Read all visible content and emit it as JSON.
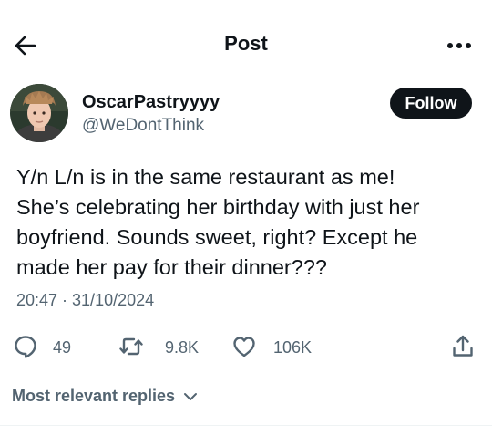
{
  "header": {
    "title": "Post",
    "back_icon": "arrow-left-icon",
    "more_icon": "more-horizontal-icon"
  },
  "author": {
    "display_name": "OscarPastryyyy",
    "handle": "@WeDontThink",
    "avatar_icon": "avatar-photo"
  },
  "follow_button": {
    "label": "Follow",
    "bg_color": "#0f1419",
    "text_color": "#ffffff"
  },
  "tweet": {
    "lines": [
      "Y/n L/n is in the same restaurant as me!",
      "She’s celebrating her birthday with just her",
      "boyfriend. Sounds sweet, right? Except he",
      "made her pay for their dinner???"
    ],
    "timestamp": "20:47 · 31/10/2024"
  },
  "actions": {
    "replies": {
      "icon": "reply-icon",
      "count": "49"
    },
    "reposts": {
      "icon": "repost-icon",
      "count": "9.8K"
    },
    "likes": {
      "icon": "heart-icon",
      "count": "106K"
    },
    "share": {
      "icon": "share-icon"
    }
  },
  "replies_sort": {
    "label": "Most relevant replies",
    "icon": "chevron-down-icon"
  },
  "colors": {
    "text_primary": "#0f1419",
    "text_secondary": "#536471",
    "divider": "#eff3f4"
  }
}
